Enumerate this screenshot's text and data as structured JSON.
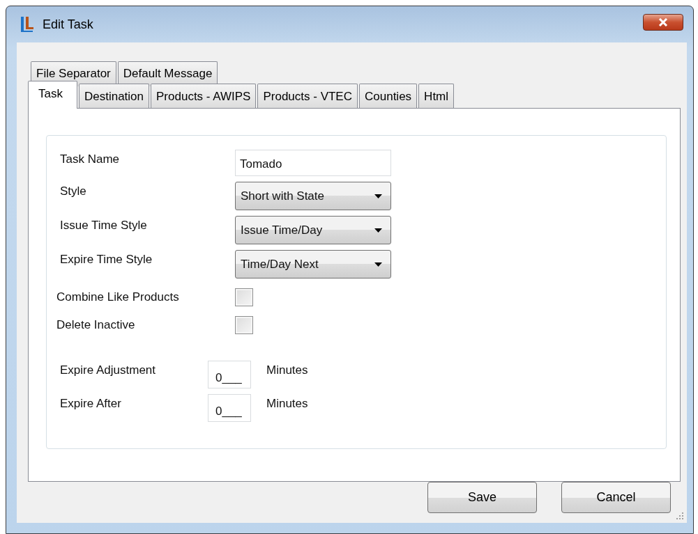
{
  "window": {
    "title": "Edit Task"
  },
  "tab_rows": [
    {
      "tabs": [
        {
          "label": "File Separator",
          "selected": false
        },
        {
          "label": "Default Message",
          "selected": false
        }
      ]
    },
    {
      "tabs": [
        {
          "label": "Task",
          "selected": true
        },
        {
          "label": "Destination",
          "selected": false
        },
        {
          "label": "Products - AWIPS",
          "selected": false
        },
        {
          "label": "Products - VTEC",
          "selected": false
        },
        {
          "label": "Counties",
          "selected": false
        },
        {
          "label": "Html",
          "selected": false
        }
      ]
    }
  ],
  "form": {
    "fields": [
      {
        "kind": "text",
        "label": "Task Name",
        "value": "Tomado"
      },
      {
        "kind": "dropdown",
        "label": "Style",
        "value": "Short with State"
      },
      {
        "kind": "dropdown",
        "label": "Issue Time Style",
        "value": "Issue Time/Day"
      },
      {
        "kind": "dropdown",
        "label": "Expire Time Style",
        "value": "Time/Day Next"
      },
      {
        "kind": "checkbox",
        "label": "Combine Like Products",
        "checked": false
      },
      {
        "kind": "checkbox",
        "label": "Delete Inactive",
        "checked": false
      },
      {
        "kind": "number",
        "label": "Expire Adjustment",
        "value": "0___",
        "unit": "Minutes"
      },
      {
        "kind": "number",
        "label": "Expire After",
        "value": "0___",
        "unit": "Minutes"
      }
    ]
  },
  "buttons": [
    {
      "label": "Save"
    },
    {
      "label": "Cancel"
    }
  ]
}
